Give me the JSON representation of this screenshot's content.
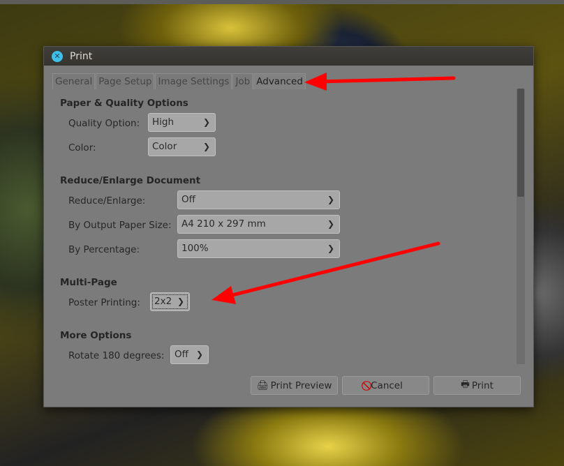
{
  "window": {
    "title": "Print"
  },
  "tabs": [
    {
      "label": "General"
    },
    {
      "label": "Page Setup"
    },
    {
      "label": "Image Settings"
    },
    {
      "label": "Job"
    },
    {
      "label": "Advanced",
      "active": true
    }
  ],
  "sections": {
    "paper_quality": {
      "title": "Paper & Quality Options",
      "quality_label": "Quality Option:",
      "quality_value": "High",
      "color_label": "Color:",
      "color_value": "Color"
    },
    "reduce": {
      "title": "Reduce/Enlarge Document",
      "reduce_label": "Reduce/Enlarge:",
      "reduce_value": "Off",
      "paper_label": "By Output Paper Size:",
      "paper_value": "A4 210 x 297 mm",
      "percent_label": "By Percentage:",
      "percent_value": "100%"
    },
    "multipage": {
      "title": "Multi-Page",
      "poster_label": "Poster Printing:",
      "poster_value": "2x2"
    },
    "more": {
      "title": "More Options",
      "rotate_label": "Rotate 180 degrees:",
      "rotate_value": "Off"
    }
  },
  "buttons": {
    "preview": "Print Preview",
    "cancel": "Cancel",
    "print": "Print"
  },
  "colors": {
    "annotation_arrow": "#ff0000",
    "close_button": "#3ec0e8"
  }
}
